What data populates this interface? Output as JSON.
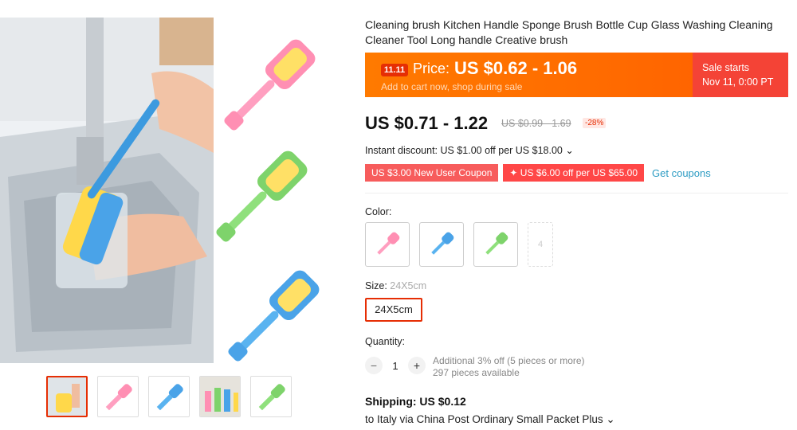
{
  "product": {
    "title": "Cleaning brush Kitchen Handle Sponge Brush Bottle Cup Glass Washing Cleaning Cleaner Tool Long handle Creative brush"
  },
  "promo": {
    "badge": "11.11",
    "price_label": "Price:",
    "price_range": "US $0.62 - 1.06",
    "subtitle": "Add to cart now, shop during sale",
    "sale_line1": "Sale starts",
    "sale_line2": "Nov 11, 0:00 PT",
    "accent": "#ff6a00",
    "sale_bg": "#f44336"
  },
  "price": {
    "current": "US $0.71 - 1.22",
    "original": "US $0.99 - 1.69",
    "discount": "-28%"
  },
  "instant_discount": "Instant discount: US $1.00 off per US $18.00 ⌄",
  "coupons": [
    {
      "label": "US $3.00 New User Coupon"
    },
    {
      "label": "✦ US $6.00 off per US $65.00"
    }
  ],
  "get_coupons": "Get coupons",
  "color": {
    "label": "Color:",
    "options": [
      {
        "name": "pink",
        "color": "#ff8fb3"
      },
      {
        "name": "blue",
        "color": "#4aa3e8"
      },
      {
        "name": "green",
        "color": "#7ed36b"
      },
      {
        "name": "4",
        "color": ""
      }
    ]
  },
  "size": {
    "label": "Size:",
    "selected": "24X5cm",
    "option": "24X5cm"
  },
  "quantity": {
    "label": "Quantity:",
    "minus": "−",
    "plus": "+",
    "value": "1",
    "info_line1": "Additional 3% off (5 pieces or more)",
    "info_line2": "297 pieces available"
  },
  "shipping": {
    "title": "Shipping: US $0.12",
    "method": "to Italy via China Post Ordinary Small Packet Plus ⌄"
  }
}
